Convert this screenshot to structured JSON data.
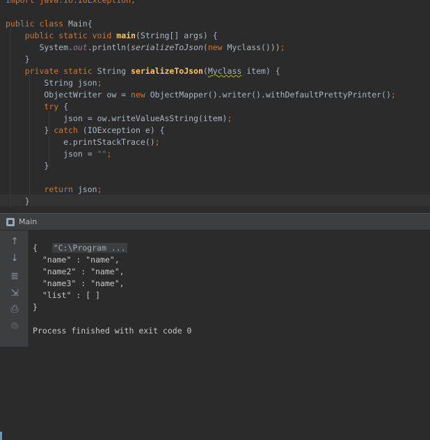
{
  "editor": {
    "lines": [
      [
        {
          "t": "import java.io.IOException;",
          "c": "kw"
        }
      ],
      [],
      [
        {
          "t": "public class ",
          "c": "kw"
        },
        {
          "t": "Main{"
        }
      ],
      [
        {
          "t": "    "
        },
        {
          "t": "public static void ",
          "c": "kw"
        },
        {
          "t": "main",
          "c": "fn"
        },
        {
          "t": "(String[] args) {"
        }
      ],
      [
        {
          "t": "       System."
        },
        {
          "t": "out",
          "c": "st"
        },
        {
          "t": ".println("
        },
        {
          "t": "serializeToJson",
          "c": "it"
        },
        {
          "t": "("
        },
        {
          "t": "new ",
          "c": "kw"
        },
        {
          "t": "Myclass()))"
        },
        {
          "t": ";",
          "c": "kw"
        }
      ],
      [
        {
          "t": "    }"
        }
      ],
      [
        {
          "t": "    "
        },
        {
          "t": "private static ",
          "c": "kw"
        },
        {
          "t": "String "
        },
        {
          "t": "serializeToJson",
          "c": "fn"
        },
        {
          "t": "("
        },
        {
          "t": "Myclass",
          "c": "squig"
        },
        {
          "t": " item) {"
        }
      ],
      [
        {
          "t": "        String json"
        },
        {
          "t": ";",
          "c": "kw"
        }
      ],
      [
        {
          "t": "        ObjectWriter ow = "
        },
        {
          "t": "new ",
          "c": "kw"
        },
        {
          "t": "ObjectMapper().writer().withDefaultPrettyPrinter()"
        },
        {
          "t": ";",
          "c": "kw"
        }
      ],
      [
        {
          "t": "        "
        },
        {
          "t": "try ",
          "c": "kw"
        },
        {
          "t": "{"
        }
      ],
      [
        {
          "t": "            json = ow.writeValueAsString(item)"
        },
        {
          "t": ";",
          "c": "kw"
        }
      ],
      [
        {
          "t": "        } "
        },
        {
          "t": "catch ",
          "c": "kw"
        },
        {
          "t": "(IOException e) {"
        }
      ],
      [
        {
          "t": "            e.printStackTrace()"
        },
        {
          "t": ";",
          "c": "kw"
        }
      ],
      [
        {
          "t": "            json = "
        },
        {
          "t": "\"\"",
          "c": "str"
        },
        {
          "t": ";",
          "c": "kw"
        }
      ],
      [
        {
          "t": "        }"
        }
      ],
      [],
      [
        {
          "t": "        "
        },
        {
          "t": "return ",
          "c": "kw"
        },
        {
          "t": "json"
        },
        {
          "t": ";",
          "c": "kw"
        }
      ],
      [
        {
          "t": "    }"
        }
      ]
    ]
  },
  "run_panel": {
    "tab_label": "Main"
  },
  "toolbar": {
    "buttons": [
      {
        "name": "rerun-up-icon",
        "glyph": "↑"
      },
      {
        "name": "down-arrow-icon",
        "glyph": "↓"
      },
      {
        "name": "soft-wrap-icon",
        "glyph": "≣"
      },
      {
        "name": "scroll-to-end-icon",
        "glyph": "⇲"
      },
      {
        "name": "print-icon",
        "glyph": "⎙"
      },
      {
        "name": "trash-icon",
        "glyph": "♲"
      }
    ]
  },
  "console": {
    "command": "\"C:\\Program ...",
    "output": [
      "{",
      "  \"name\" : \"name\",",
      "  \"name2\" : \"name\",",
      "  \"name3\" : \"name\",",
      "  \"list\" : [ ]",
      "}",
      "",
      "Process finished with exit code 0"
    ]
  }
}
